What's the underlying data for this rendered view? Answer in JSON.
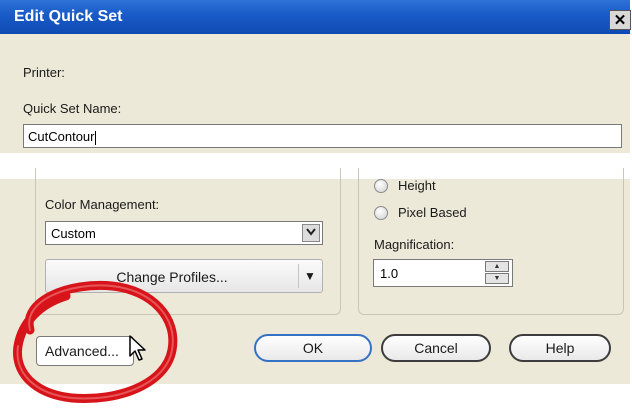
{
  "dialog": {
    "title": "Edit Quick Set",
    "close_glyph": "✕",
    "printer_label": "Printer:",
    "quickset_label": "Quick Set Name:",
    "quickset_value": "CutContour"
  },
  "color_management": {
    "label": "Color Management:",
    "selected": "Custom",
    "change_profiles_label": "Change Profiles...",
    "split_arrow": "▼"
  },
  "size_options": {
    "radio_height": "Height",
    "radio_pixel": "Pixel Based",
    "magnification_label": "Magnification:",
    "magnification_value": "1.0"
  },
  "buttons": {
    "advanced": "Advanced...",
    "ok": "OK",
    "cancel": "Cancel",
    "help": "Help"
  },
  "colors": {
    "titlebar": "#1a5cc8",
    "dialog_bg": "#ece9d8",
    "highlight_red": "#d8141b"
  },
  "icons": {
    "close": "close-icon",
    "dropdown": "chevron-down-icon",
    "spin_up": "arrow-up-icon",
    "spin_down": "arrow-down-icon",
    "cursor": "mouse-pointer-icon"
  }
}
